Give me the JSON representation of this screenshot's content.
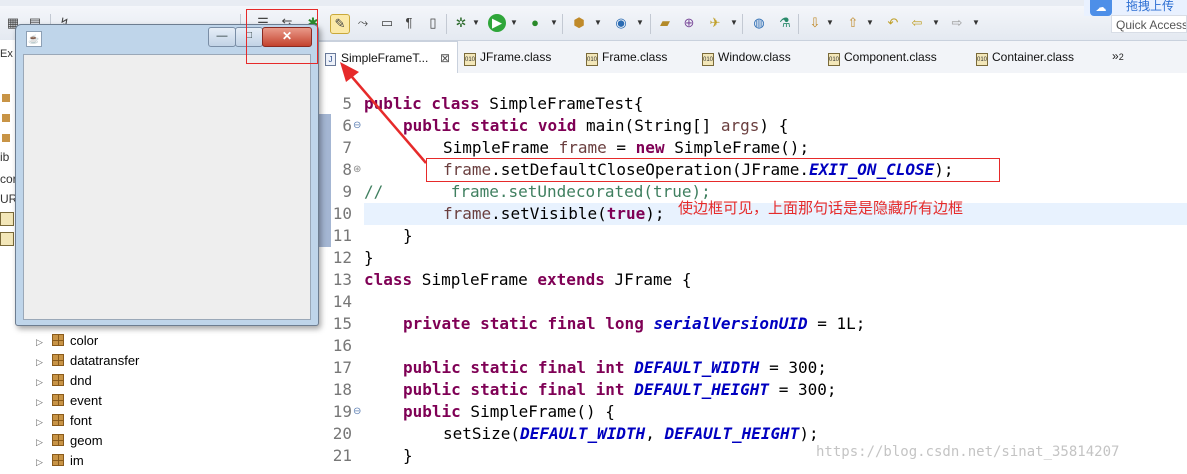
{
  "toolbar": {
    "icons": [
      "save-icon",
      "print-icon",
      "format-icon",
      "outline-icon",
      "toggle-mark-icon",
      "debug-icon",
      "run-icon",
      "external-tools-icon",
      "new-package-icon",
      "new-class-icon",
      "open-type-icon",
      "search-icon",
      "globe-icon",
      "next-annotation-icon",
      "prev-annotation-icon",
      "back-icon",
      "forward-icon"
    ]
  },
  "quick_access": {
    "placeholder": "Quick Access"
  },
  "upload_widget": {
    "label": "拖拽上传"
  },
  "explorer": {
    "tab_clip": "Ex",
    "left_clips": [
      "ib",
      "cor",
      "URE"
    ],
    "packages": [
      {
        "label": "color"
      },
      {
        "label": "datatransfer"
      },
      {
        "label": "dnd"
      },
      {
        "label": "event"
      },
      {
        "label": "font"
      },
      {
        "label": "geom"
      },
      {
        "label": "im"
      }
    ]
  },
  "frame_window": {
    "min_symbol": "—",
    "max_symbol": "□",
    "close_symbol": "✕"
  },
  "editor_tabs": [
    {
      "label": "SimpleFrameT...",
      "active": true,
      "close": "⊠"
    },
    {
      "label": "JFrame.class"
    },
    {
      "label": "Frame.class"
    },
    {
      "label": "Window.class"
    },
    {
      "label": "Component.class"
    },
    {
      "label": "Container.class"
    }
  ],
  "tab_overflow": {
    "symbol": "»",
    "count": "2"
  },
  "code_lines": [
    {
      "n": "5"
    },
    {
      "n": "6"
    },
    {
      "n": "7"
    },
    {
      "n": "8"
    },
    {
      "n": "9"
    },
    {
      "n": "10"
    },
    {
      "n": "11"
    },
    {
      "n": "12"
    },
    {
      "n": "13"
    },
    {
      "n": "14"
    },
    {
      "n": "15"
    },
    {
      "n": "16"
    },
    {
      "n": "17"
    },
    {
      "n": "18"
    },
    {
      "n": "19"
    },
    {
      "n": "20"
    },
    {
      "n": "21"
    }
  ],
  "code": {
    "l5": {
      "kw1": "public class",
      "rest": " SimpleFrameTest{"
    },
    "l6": {
      "kw": "public static void",
      "a": " main(String[] ",
      "param": "args",
      "b": ") {"
    },
    "l7": {
      "a": "SimpleFrame ",
      "var": "frame",
      "b": " = ",
      "kw": "new",
      "c": " SimpleFrame();"
    },
    "l8": {
      "var": "frame",
      "a": ".setDefaultCloseOperation(JFrame.",
      "cst": "EXIT_ON_CLOSE",
      "b": ");"
    },
    "l9": {
      "cmt": "//       frame.setUndecorated(true);"
    },
    "l10": {
      "var": "frame",
      "a": ".setVisible(",
      "kw": "true",
      "b": ");"
    },
    "l11": {
      "a": "}"
    },
    "l12": {
      "a": "}"
    },
    "l13": {
      "kw1": "class",
      "a": " SimpleFrame ",
      "kw2": "extends",
      "b": " JFrame {"
    },
    "l15": {
      "kw": "private static final long",
      "a": " ",
      "cst": "serialVersionUID",
      "b": " = 1L;"
    },
    "l17": {
      "kw": "public static final int",
      "a": " ",
      "cst": "DEFAULT_WIDTH",
      "b": " = 300;"
    },
    "l18": {
      "kw": "public static final int",
      "a": " ",
      "cst": "DEFAULT_HEIGHT",
      "b": " = 300;"
    },
    "l19": {
      "kw": "public",
      "a": " SimpleFrame() {"
    },
    "l20": {
      "a": "setSize(",
      "cst1": "DEFAULT_WIDTH",
      "b": ", ",
      "cst2": "DEFAULT_HEIGHT",
      "c": ");"
    },
    "l21": {
      "a": "}"
    }
  },
  "annotation": {
    "note": "使边框可见，上面那句话是是隐藏所有边框",
    "color": "#e62a2a"
  },
  "watermark": "https://blog.csdn.net/sinat_35814207"
}
